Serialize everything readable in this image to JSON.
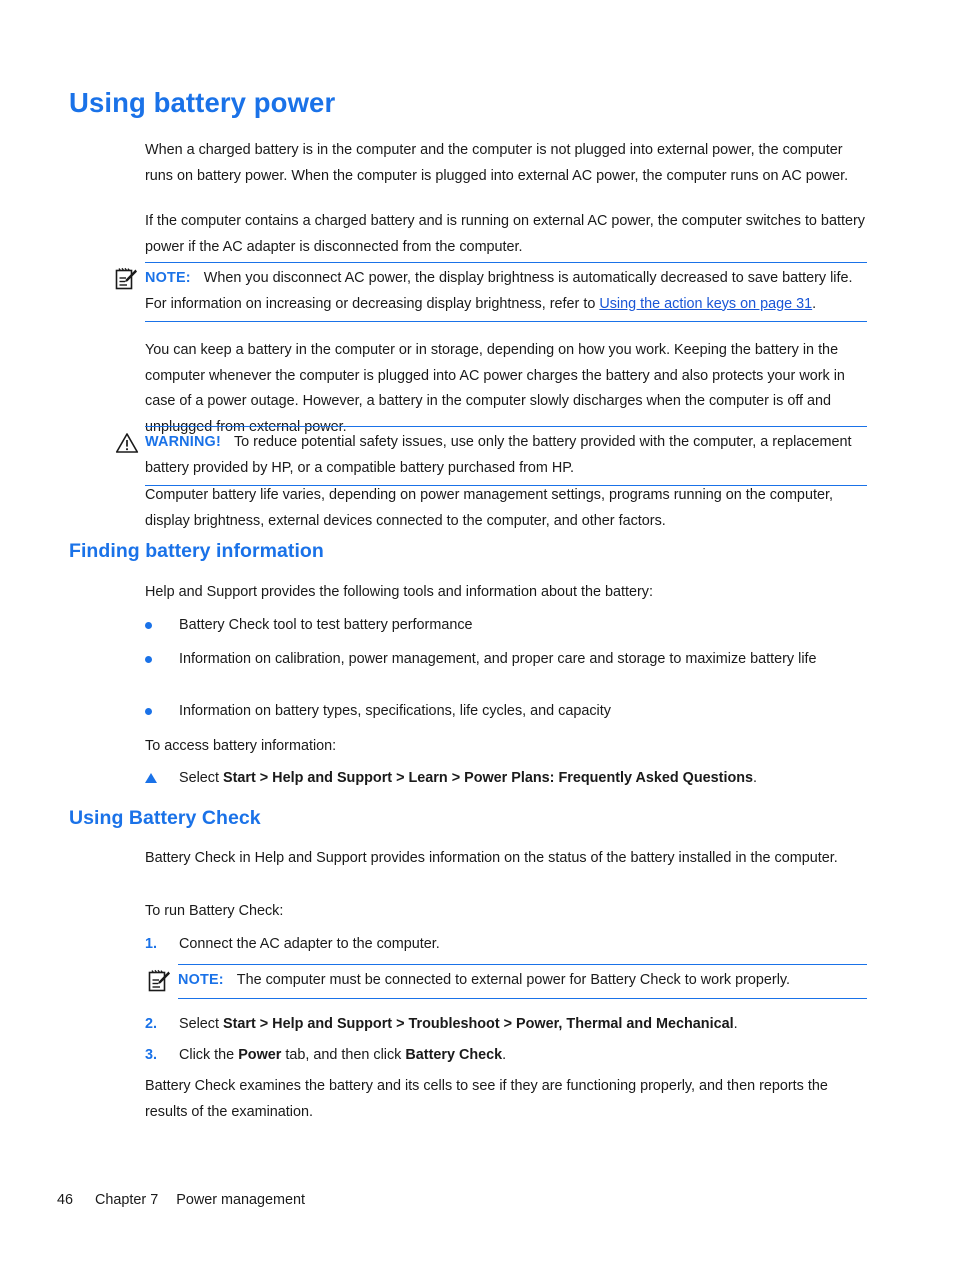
{
  "document": {
    "title": "Using battery power"
  },
  "headings": {
    "h1": "Using battery power",
    "finding": "Finding battery information",
    "battery_check": "Using Battery Check"
  },
  "paragraphs": {
    "p1": "When a charged battery is in the computer and the computer is not plugged into external power, the computer runs on battery power. When the computer is plugged into external AC power, the computer runs on AC power.",
    "p2": "If the computer contains a charged battery and is running on external AC power, the computer switches to battery power if the AC adapter is disconnected from the computer.",
    "p3": "You can keep a battery in the computer or in storage, depending on how you work. Keeping the battery in the computer whenever the computer is plugged into AC power charges the battery and also protects your work in case of a power outage. However, a battery in the computer slowly discharges when the computer is off and unplugged from external power.",
    "p4": "Computer battery life varies, depending on power management settings, programs running on the computer, display brightness, external devices connected to the computer, and other factors.",
    "p5": "Help and Support provides the following tools and information about the battery:",
    "p6": "To access battery information:",
    "p7": "Battery Check in Help and Support provides information on the status of the battery installed in the computer.",
    "p8": "To run Battery Check:",
    "p9": "Battery Check examines the battery and its cells to see if they are functioning properly, and then reports the results of the examination."
  },
  "note1": {
    "icon": "note-pad-pencil-icon",
    "label": "NOTE:",
    "text_before_link": "When you disconnect AC power, the display brightness is automatically decreased to save battery life. For information on increasing or decreasing display brightness, refer to ",
    "link_text": "Using the action keys on page 31",
    "text_after_link": "."
  },
  "warning": {
    "icon": "warning-triangle-icon",
    "label": "WARNING!",
    "text": "To reduce potential safety issues, use only the battery provided with the computer, a replacement battery provided by HP, or a compatible battery purchased from HP."
  },
  "note2": {
    "icon": "note-pad-pencil-icon",
    "label": "NOTE:",
    "text": "The computer must be connected to external power for Battery Check to work properly."
  },
  "bullets": [
    "Battery Check tool to test battery performance",
    "Information on calibration, power management, and proper care and storage to maximize battery life",
    "Information on battery types, specifications, life cycles, and capacity"
  ],
  "access_step": {
    "marker": "triangle-bullet",
    "prefix": "Select ",
    "bold": "Start > Help and Support > Learn > Power Plans: Frequently Asked Questions",
    "suffix": "."
  },
  "steps": [
    {
      "number": "1.",
      "prefix": "Connect the AC adapter to the computer.",
      "bold": "",
      "middle": "",
      "bold2": "",
      "suffix": ""
    },
    {
      "number": "2.",
      "prefix": "Select ",
      "bold": "Start > Help and Support > Troubleshoot > Power, Thermal and Mechanical",
      "middle": "",
      "bold2": "",
      "suffix": "."
    },
    {
      "number": "3.",
      "prefix": "Click the ",
      "bold": "Power",
      "middle": " tab, and then click ",
      "bold2": "Battery Check",
      "suffix": "."
    }
  ],
  "footer": {
    "page_number": "46",
    "chapter": "Chapter 7",
    "chapter_title": "Power management"
  },
  "colors": {
    "accent_blue": "#1a72e8",
    "link_blue": "#1a56d6",
    "body_text": "#1a1a1a",
    "page_background": "#ffffff"
  }
}
